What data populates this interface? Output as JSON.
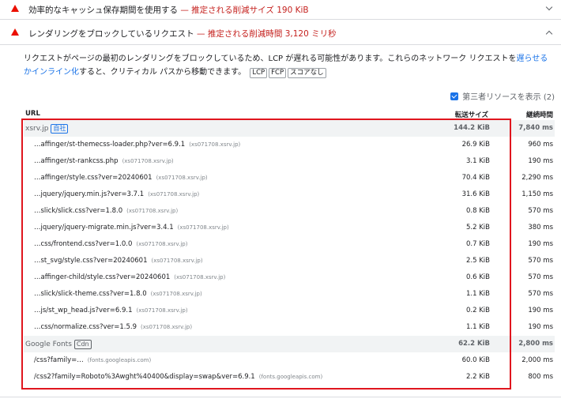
{
  "audits": [
    {
      "title": "効率的なキャッシュ保存期間を使用する",
      "savings": "— 推定される削減サイズ 190 KiB"
    },
    {
      "title": "レンダリングをブロックしているリクエスト",
      "savings": "— 推定される削減時間 3,120 ミリ秒"
    }
  ],
  "description": {
    "before": "リクエストがページの最初のレンダリングをブロックしているため、LCP が遅れる可能性があります。これらのネットワーク リクエストを",
    "link": "遅らせるかインライン化",
    "after": "すると、クリティカル パスから移動できます。",
    "chips": [
      "LCP",
      "FCP",
      "スコアなし"
    ]
  },
  "third_party": {
    "label": "第三者リソースを表示 (2)",
    "checked": true
  },
  "table": {
    "headers": {
      "url": "URL",
      "size": "転送サイズ",
      "time": "継続時間"
    },
    "groups": [
      {
        "name": "xsrv.jp",
        "badge": "自社",
        "size": "144.2 KiB",
        "time": "7,840 ms",
        "rows": [
          {
            "url": "…affinger/st-themecss-loader.php?ver=6.9.1",
            "host": "(xs071708.xsrv.jp)",
            "size": "26.9 KiB",
            "time": "960 ms"
          },
          {
            "url": "…affinger/st-rankcss.php",
            "host": "(xs071708.xsrv.jp)",
            "size": "3.1 KiB",
            "time": "190 ms"
          },
          {
            "url": "…affinger/style.css?ver=20240601",
            "host": "(xs071708.xsrv.jp)",
            "size": "70.4 KiB",
            "time": "2,290 ms"
          },
          {
            "url": "…jquery/jquery.min.js?ver=3.7.1",
            "host": "(xs071708.xsrv.jp)",
            "size": "31.6 KiB",
            "time": "1,150 ms"
          },
          {
            "url": "…slick/slick.css?ver=1.8.0",
            "host": "(xs071708.xsrv.jp)",
            "size": "0.8 KiB",
            "time": "570 ms"
          },
          {
            "url": "…jquery/jquery-migrate.min.js?ver=3.4.1",
            "host": "(xs071708.xsrv.jp)",
            "size": "5.2 KiB",
            "time": "380 ms"
          },
          {
            "url": "…css/frontend.css?ver=1.0.0",
            "host": "(xs071708.xsrv.jp)",
            "size": "0.7 KiB",
            "time": "190 ms"
          },
          {
            "url": "…st_svg/style.css?ver=20240601",
            "host": "(xs071708.xsrv.jp)",
            "size": "2.5 KiB",
            "time": "570 ms"
          },
          {
            "url": "…affinger-child/style.css?ver=20240601",
            "host": "(xs071708.xsrv.jp)",
            "size": "0.6 KiB",
            "time": "570 ms"
          },
          {
            "url": "…slick/slick-theme.css?ver=1.8.0",
            "host": "(xs071708.xsrv.jp)",
            "size": "1.1 KiB",
            "time": "570 ms"
          },
          {
            "url": "…js/st_wp_head.js?ver=6.9.1",
            "host": "(xs071708.xsrv.jp)",
            "size": "0.2 KiB",
            "time": "190 ms"
          },
          {
            "url": "…css/normalize.css?ver=1.5.9",
            "host": "(xs071708.xsrv.jp)",
            "size": "1.1 KiB",
            "time": "190 ms"
          }
        ]
      },
      {
        "name": "Google Fonts",
        "badge": "Cdn",
        "size": "62.2 KiB",
        "time": "2,800 ms",
        "rows": [
          {
            "url": "/css?family=…",
            "host": "(fonts.googleapis.com)",
            "size": "60.0 KiB",
            "time": "2,000 ms"
          },
          {
            "url": "/css2?family=Roboto%3Awght%40400&display=swap&ver=6.9.1",
            "host": "(fonts.googleapis.com)",
            "size": "2.2 KiB",
            "time": "800 ms"
          }
        ]
      }
    ]
  },
  "colors": {
    "fail": "#eb0f00",
    "savings": "#c5221f",
    "link": "#1a73e8",
    "highlight": "#e0161e"
  }
}
